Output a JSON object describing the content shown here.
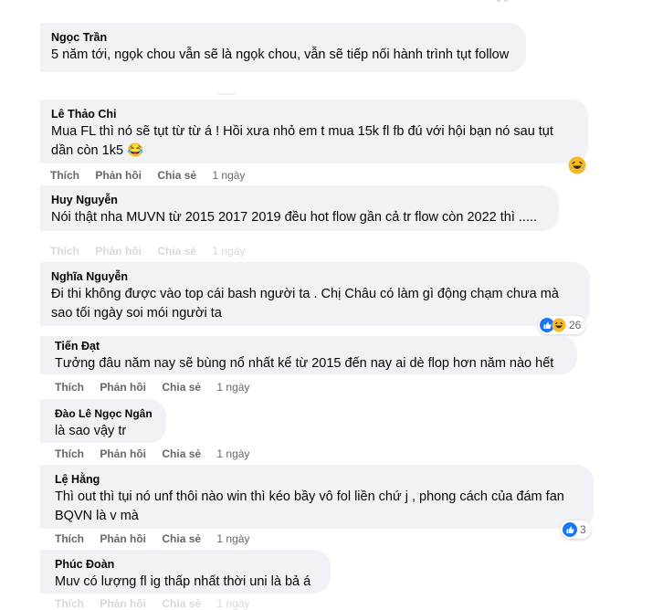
{
  "actions": {
    "like": "Thích",
    "reply": "Phản hồi",
    "share": "Chia sẻ"
  },
  "comments": [
    {
      "author": "Ngọc Trần",
      "text": "5 năm tới, ngọk chou vẫn sẽ là ngọk chou, vẫn sẽ tiếp nối hành trình tụt follow"
    },
    {
      "author": "Lê Thảo Chi",
      "text": "Mua FL thì nó sẽ tụt từ từ á ! Hồi xưa nhỏ em t mua 15k fl fb đú với hội bạn nó sau tụt dần còn 1k5 😂",
      "time": "1 ngày"
    },
    {
      "author": "Huy Nguyễn",
      "text": "Nói thật nha MUVN từ 2015 2017 2019 đều hot flow gần cả tr flow còn 2022 thì .....",
      "time": "1 ngày"
    },
    {
      "author": "Nghĩa Nguyễn",
      "text": "Đi thi không được vào top cái bash người ta . Chị Châu có làm gì động chạm chưa mà sao tối ngày soi mói người ta",
      "reactions": "26"
    },
    {
      "author": "Tiến Đạt",
      "text": "Tưởng đâu năm nay sẽ bùng nổ nhất kể từ 2015 đến nay ai dè flop hơn năm nào hết",
      "time": "1 ngày"
    },
    {
      "author": "Đào Lê Ngọc Ngân",
      "text": "là sao vậy tr",
      "time": "1 ngày"
    },
    {
      "author": "Lệ Hằng",
      "text": "Thì out thì tụi nó unf thôi nào win thì kéo bầy vô fol liền chứ j , phong cách của đám fan BQVN là v mà",
      "time": "1 ngày",
      "reactions": "3"
    },
    {
      "author": "Phúc Đoàn",
      "text": "Muv có lượng fl ig thấp nhất thời uni là bả á",
      "time": "1 ngày"
    }
  ],
  "colors": {
    "bubble": "#f0f2f5",
    "meta": "#65676b",
    "like_blue": "#1877f2"
  }
}
